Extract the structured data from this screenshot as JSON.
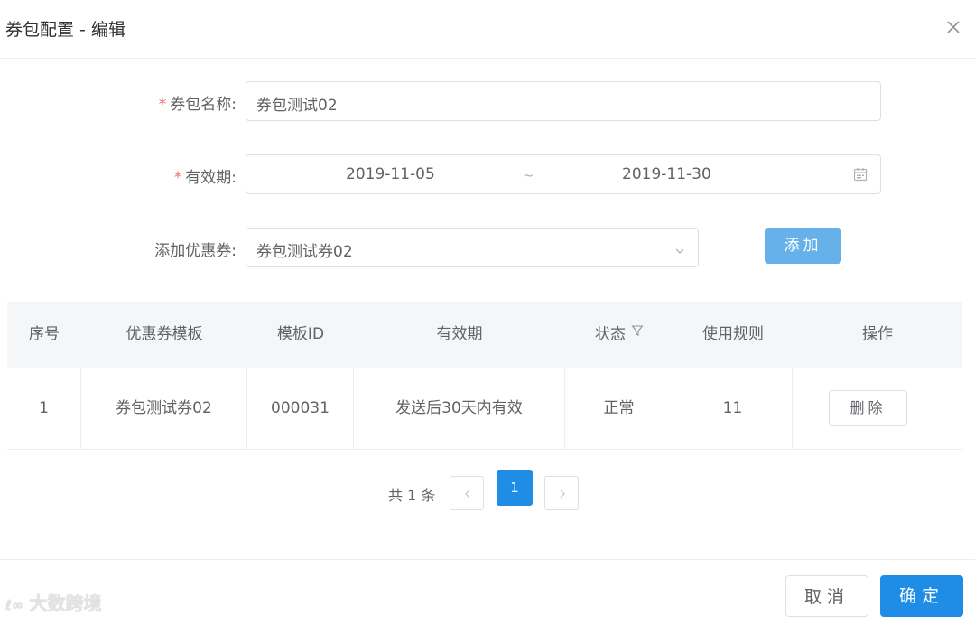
{
  "dialog": {
    "title": "券包配置 - 编辑"
  },
  "form": {
    "name": {
      "label": "券包名称:",
      "required_mark": "*",
      "value": "券包测试02"
    },
    "validity": {
      "label": "有效期:",
      "required_mark": "*",
      "start": "2019-11-05",
      "separator": "~",
      "end": "2019-11-30"
    },
    "coupon": {
      "label": "添加优惠券:",
      "value": "券包测试券02",
      "add_label": "添加"
    }
  },
  "table": {
    "columns": [
      "序号",
      "优惠券模板",
      "模板ID",
      "有效期",
      "状态",
      "使用规则",
      "操作"
    ],
    "rows": [
      {
        "index": "1",
        "template": "券包测试券02",
        "template_id": "000031",
        "validity": "发送后30天内有效",
        "status": "正常",
        "rule": "11",
        "action": "删除"
      }
    ]
  },
  "pagination": {
    "total": "共 1 条",
    "current": "1"
  },
  "footer": {
    "cancel": "取消",
    "confirm": "确定"
  },
  "watermark": "大数跨境",
  "colors": {
    "primary": "#1f8ce6",
    "add_button": "#66b1e9",
    "required": "#f56c6c"
  }
}
